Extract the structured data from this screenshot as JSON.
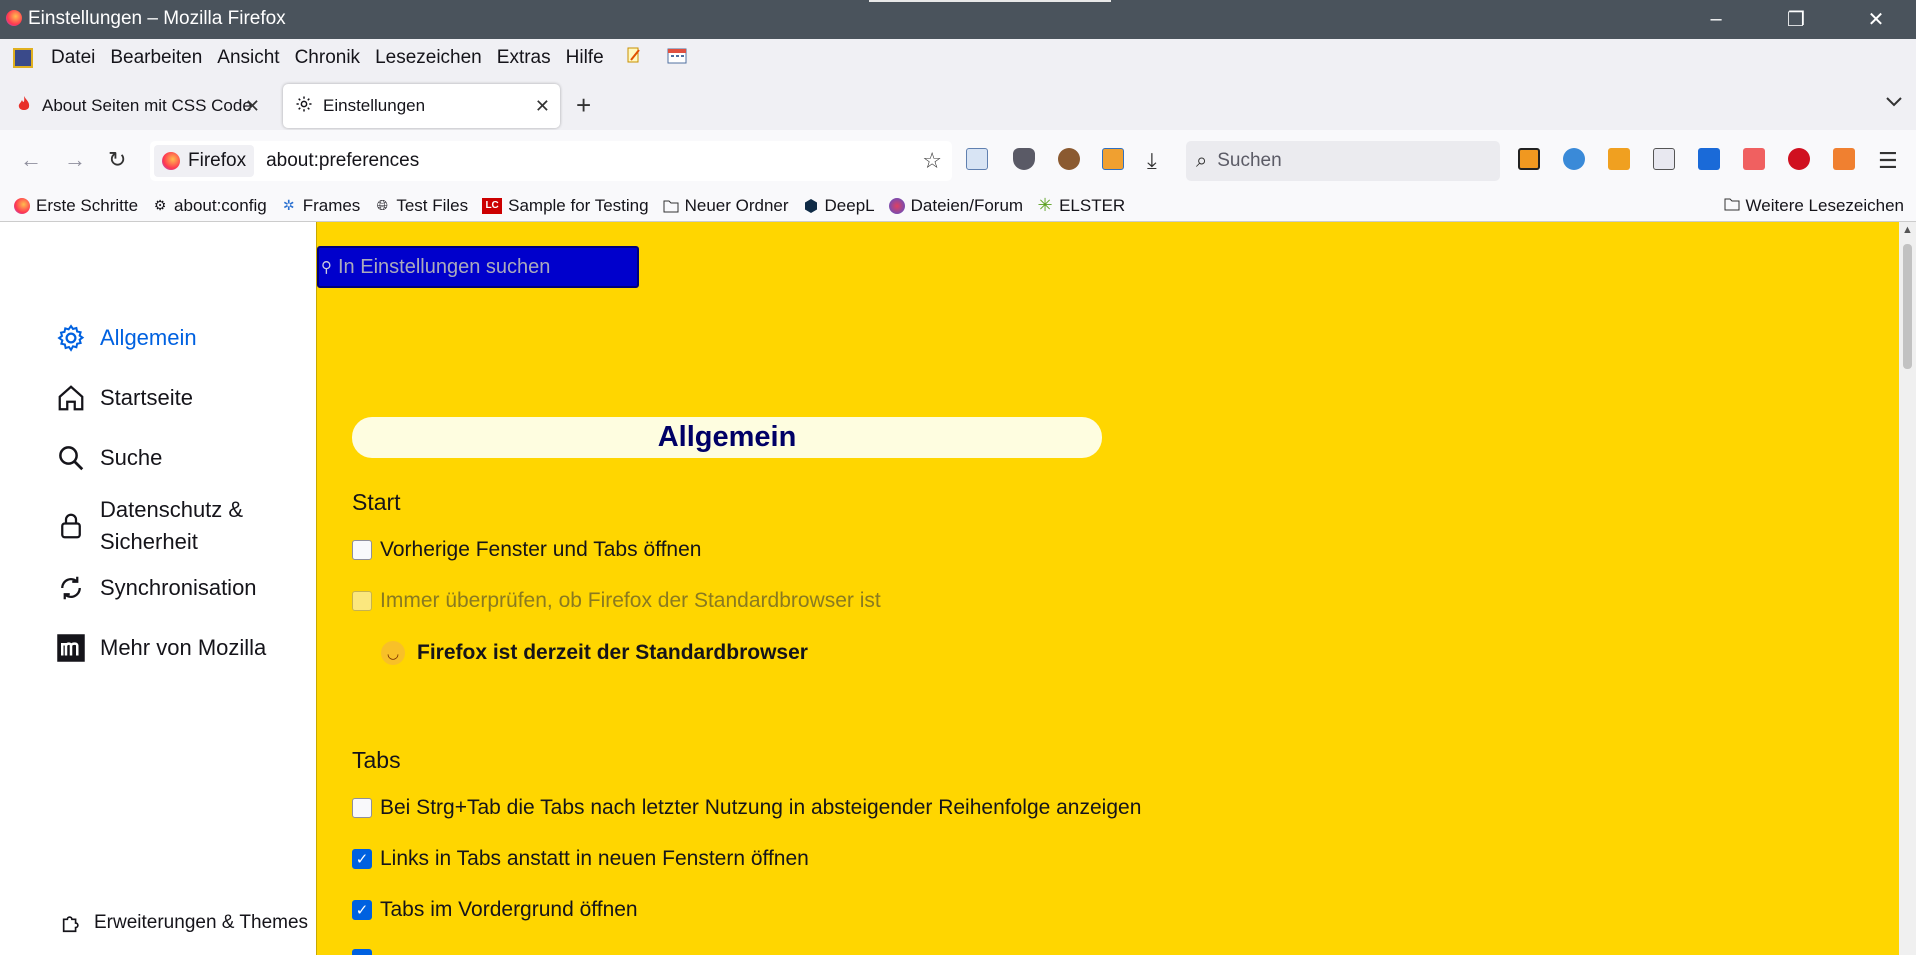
{
  "window": {
    "title": "Einstellungen – Mozilla Firefox",
    "minimize": "–",
    "restore": "❐",
    "close": "✕"
  },
  "menu": {
    "items": [
      "Datei",
      "Bearbeiten",
      "Ansicht",
      "Chronik",
      "Lesezeichen",
      "Extras",
      "Hilfe"
    ]
  },
  "tabs": [
    {
      "label": "About Seiten mit CSS Code",
      "close": "✕"
    },
    {
      "label": "Einstellungen",
      "close": "✕"
    }
  ],
  "tabbar": {
    "new_tab": "+",
    "list_all": "⌄"
  },
  "nav": {
    "back": "←",
    "forward": "→",
    "reload": "↻"
  },
  "urlbar": {
    "identity": "Firefox",
    "url": "about:preferences",
    "star": "☆"
  },
  "search": {
    "placeholder": "Suchen",
    "icon": "⌕"
  },
  "bookmarks": {
    "items": [
      {
        "label": "Erste Schritte",
        "icon": "firefox-icon"
      },
      {
        "label": "about:config",
        "icon": "gear-icon"
      },
      {
        "label": "Frames",
        "icon": "loading-icon"
      },
      {
        "label": "Test Files",
        "icon": "globe-icon"
      },
      {
        "label": "Sample for Testing",
        "icon": "lc-icon"
      },
      {
        "label": "Neuer Ordner",
        "icon": "folder-icon"
      },
      {
        "label": "DeepL",
        "icon": "deepl-icon"
      },
      {
        "label": "Dateien/Forum",
        "icon": "forum-icon"
      },
      {
        "label": "ELSTER",
        "icon": "elster-icon"
      }
    ],
    "more": "Weitere Lesezeichen"
  },
  "sidebar": {
    "items": [
      {
        "label": "Allgemein",
        "icon": "gear-icon",
        "active": true
      },
      {
        "label": "Startseite",
        "icon": "home-icon"
      },
      {
        "label": "Suche",
        "icon": "search-icon"
      },
      {
        "label": "Datenschutz &",
        "label2": "Sicherheit",
        "icon": "lock-icon"
      },
      {
        "label": "Synchronisation",
        "icon": "sync-icon"
      },
      {
        "label": "Mehr von Mozilla",
        "icon": "mozilla-icon"
      }
    ],
    "footer": "Erweiterungen & Themes"
  },
  "content": {
    "search_placeholder": "In Einstellungen suchen",
    "heading": "Allgemein",
    "start_title": "Start",
    "start_options": [
      {
        "label": "Vorherige Fenster und Tabs öffnen",
        "checked": false,
        "disabled": false
      },
      {
        "label": "Immer überprüfen, ob Firefox der Standardbrowser ist",
        "checked": false,
        "disabled": true
      }
    ],
    "default_status": "Firefox ist derzeit der Standardbrowser",
    "tabs_title": "Tabs",
    "tabs_options": [
      {
        "label": "Bei Strg+Tab die Tabs nach letzter Nutzung in absteigender Reihenfolge anzeigen",
        "checked": false
      },
      {
        "label": "Links in Tabs anstatt in neuen Fenstern öffnen",
        "checked": true
      },
      {
        "label": "Tabs im Vordergrund öffnen",
        "checked": true
      }
    ],
    "check_mark": "✓"
  },
  "colors": {
    "content_bg": "#ffd600",
    "accent": "#0061e0",
    "searchbox_bg": "#0000cc",
    "heading": "#000066"
  }
}
